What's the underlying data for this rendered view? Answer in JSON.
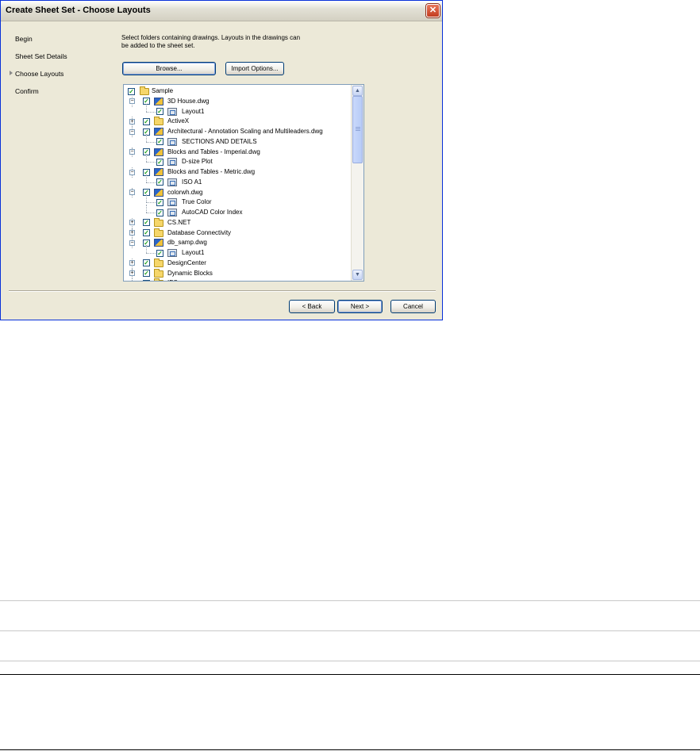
{
  "window": {
    "title": "Create Sheet Set - Choose Layouts",
    "close_glyph": "✕"
  },
  "nav": {
    "items": [
      {
        "label": "Begin",
        "current": false
      },
      {
        "label": "Sheet Set Details",
        "current": false
      },
      {
        "label": "Choose Layouts",
        "current": true
      },
      {
        "label": "Confirm",
        "current": false
      }
    ]
  },
  "instructions": "Select folders containing drawings.  Layouts in the drawings can be added to the sheet set.",
  "buttons": {
    "browse": "Browse...",
    "import_options": "Import Options...",
    "back": "< Back",
    "next": "Next >",
    "cancel": "Cancel"
  },
  "tree": {
    "items": [
      {
        "level": 0,
        "expander": "",
        "checked": true,
        "icon": "folder-icon",
        "label": "Sample"
      },
      {
        "level": 1,
        "expander": "−",
        "checked": true,
        "icon": "dwg-icon",
        "label": "3D House.dwg"
      },
      {
        "level": 2,
        "expander": "",
        "checked": true,
        "icon": "layout-icon",
        "label": "Layout1"
      },
      {
        "level": 1,
        "expander": "+",
        "checked": true,
        "icon": "folder-icon",
        "label": "ActiveX"
      },
      {
        "level": 1,
        "expander": "−",
        "checked": true,
        "icon": "dwg-icon",
        "label": "Architectural - Annotation Scaling and Multileaders.dwg"
      },
      {
        "level": 2,
        "expander": "",
        "checked": true,
        "icon": "layout-icon",
        "label": "SECTIONS AND DETAILS"
      },
      {
        "level": 1,
        "expander": "−",
        "checked": true,
        "icon": "dwg-icon",
        "label": "Blocks and Tables - Imperial.dwg"
      },
      {
        "level": 2,
        "expander": "",
        "checked": true,
        "icon": "layout-icon",
        "label": "D-size Plot"
      },
      {
        "level": 1,
        "expander": "−",
        "checked": true,
        "icon": "dwg-icon",
        "label": "Blocks and Tables - Metric.dwg"
      },
      {
        "level": 2,
        "expander": "",
        "checked": true,
        "icon": "layout-icon",
        "label": "ISO A1"
      },
      {
        "level": 1,
        "expander": "−",
        "checked": true,
        "icon": "dwg-icon",
        "label": "colorwh.dwg"
      },
      {
        "level": 2,
        "expander": "",
        "checked": true,
        "icon": "layout-icon",
        "label": "True Color"
      },
      {
        "level": 2,
        "expander": "",
        "checked": true,
        "icon": "layout-icon",
        "label": "AutoCAD Color Index"
      },
      {
        "level": 1,
        "expander": "+",
        "checked": true,
        "icon": "folder-icon",
        "label": "CS.NET"
      },
      {
        "level": 1,
        "expander": "+",
        "checked": true,
        "icon": "folder-icon",
        "label": "Database Connectivity"
      },
      {
        "level": 1,
        "expander": "−",
        "checked": true,
        "icon": "dwg-icon",
        "label": "db_samp.dwg"
      },
      {
        "level": 2,
        "expander": "",
        "checked": true,
        "icon": "layout-icon",
        "label": "Layout1"
      },
      {
        "level": 1,
        "expander": "+",
        "checked": true,
        "icon": "folder-icon",
        "label": "DesignCenter"
      },
      {
        "level": 1,
        "expander": "+",
        "checked": true,
        "icon": "folder-icon",
        "label": "Dynamic Blocks"
      },
      {
        "level": 1,
        "expander": "+",
        "checked": true,
        "icon": "folder-icon",
        "label": "IFC"
      }
    ]
  },
  "scrollbar": {
    "up_glyph": "▲",
    "down_glyph": "▼"
  },
  "colors": {
    "dialog_face": "#ece9d8",
    "window_border": "#0831d9",
    "button_border": "#003c74",
    "check": "#21a121"
  }
}
